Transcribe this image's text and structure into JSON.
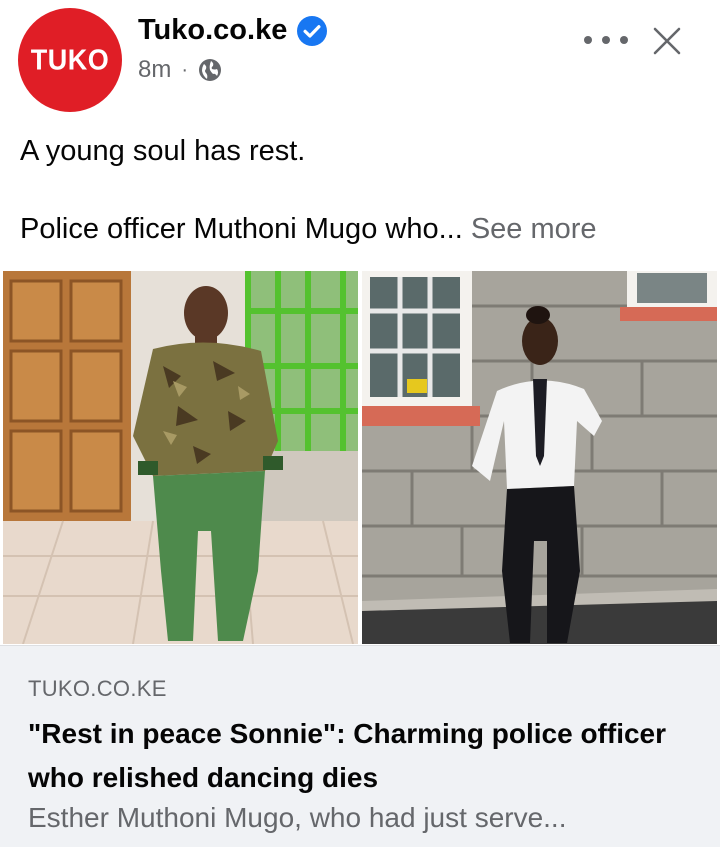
{
  "post": {
    "avatar_text": "TUKO",
    "page_name": "Tuko.co.ke",
    "time": "8m",
    "separator": "·",
    "text_line1": "A young soul has rest.",
    "text_line2": "Police officer Muthoni Mugo who...",
    "see_more": "See more"
  },
  "link_card": {
    "domain": "TUKO.CO.KE",
    "title": "\"Rest in peace Sonnie\": Charming police officer who relished dancing dies",
    "description": "Esther Muthoni Mugo, who had just serve..."
  },
  "icons": {
    "verified": "verified-badge-icon",
    "audience": "globe-icon",
    "more": "more-options-icon",
    "close": "close-icon"
  },
  "colors": {
    "brand_red": "#e01e26",
    "verified_blue": "#1877f2",
    "secondary_text": "#65676b",
    "card_bg": "#f0f2f5"
  }
}
